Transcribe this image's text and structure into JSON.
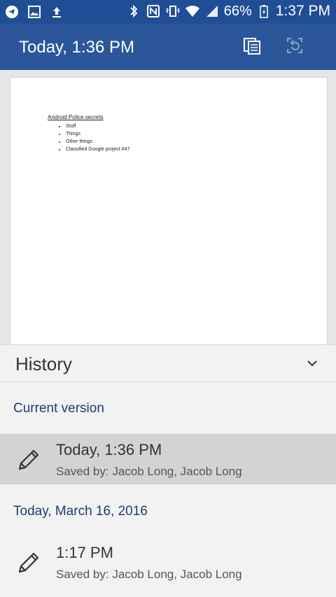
{
  "status_bar": {
    "battery": "66%",
    "time": "1:37 PM"
  },
  "app_bar": {
    "title": "Today, 1:36 PM"
  },
  "document": {
    "title": "Android Police secrets",
    "items": [
      "Stuff",
      "Things",
      "Other things",
      "Classified Google project #47"
    ]
  },
  "history": {
    "title": "History",
    "sections": [
      {
        "label": "Current version",
        "version": {
          "time": "Today, 1:36 PM",
          "saved_by": "Saved by: Jacob Long, Jacob Long"
        }
      },
      {
        "label": "Today, March 16, 2016",
        "version": {
          "time": "1:17 PM",
          "saved_by": "Saved by: Jacob Long, Jacob Long"
        }
      }
    ]
  },
  "icons": {
    "app_bar": [
      "document-pages-icon",
      "restore-icon"
    ],
    "status_left": [
      "telegram-icon",
      "gallery-icon",
      "upload-icon"
    ],
    "status_right": [
      "bluetooth-icon",
      "nfc-icon",
      "vibrate-icon",
      "wifi-icon",
      "signal-icon",
      "battery-charging-icon"
    ]
  },
  "colors": {
    "status_bar": "#1f4e96",
    "app_bar": "#2b579a",
    "section_label": "#1f3b73",
    "selected_row": "#d3d3d3"
  }
}
